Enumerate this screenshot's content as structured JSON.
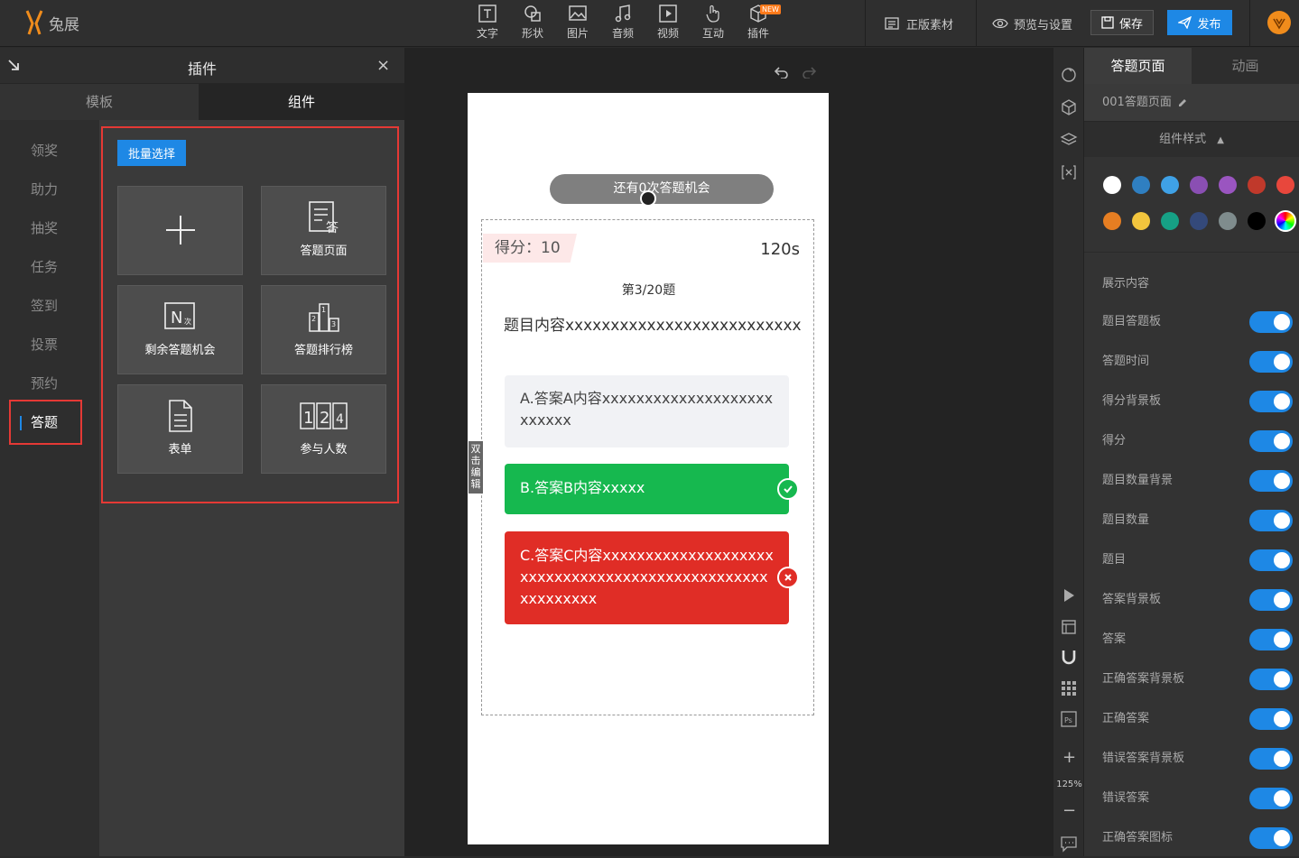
{
  "app": {
    "logo_text": "兔展"
  },
  "toolbar": {
    "tools": [
      {
        "label": "文字",
        "icon": "text-icon"
      },
      {
        "label": "形状",
        "icon": "shape-icon"
      },
      {
        "label": "图片",
        "icon": "image-icon"
      },
      {
        "label": "音频",
        "icon": "music-icon"
      },
      {
        "label": "视频",
        "icon": "video-icon"
      },
      {
        "label": "互动",
        "icon": "hand-icon"
      },
      {
        "label": "插件",
        "icon": "cube-icon",
        "badge": "NEW"
      }
    ],
    "licensed_material": "正版素材",
    "preview_settings": "预览与设置",
    "save": "保存",
    "publish": "发布"
  },
  "plugin_panel": {
    "title": "插件",
    "tabs": [
      "模板",
      "组件"
    ],
    "categories": [
      "领奖",
      "助力",
      "抽奖",
      "任务",
      "签到",
      "投票",
      "预约",
      "答题"
    ],
    "active_category": "答题",
    "batch_select": "批量选择",
    "components": [
      "",
      "答题页面",
      "剩余答题机会",
      "答题排行榜",
      "表单",
      "参与人数"
    ]
  },
  "canvas": {
    "chance_text": "还有0次答题机会",
    "score_label": "得分：10",
    "timer": "120s",
    "progress": "第3/20题",
    "question": "题目内容xxxxxxxxxxxxxxxxxxxxxxxxxx",
    "answer_a": "A.答案A内容xxxxxxxxxxxxxxxxxxxxxxxxxx",
    "answer_b": "B.答案B内容xxxxx",
    "answer_c": "C.答案C内容xxxxxxxxxxxxxxxxxxxxxxxxxxxxxxxxxxxxxxxxxxxxxxxxxxxxxxxxxx",
    "edit_tab": "双击编辑"
  },
  "tool_column": {
    "zoom": "125%"
  },
  "prop_panel": {
    "tabs": [
      "答题页面",
      "动画"
    ],
    "page_name": "001答题页面",
    "style_header": "组件样式",
    "colors": [
      "#ffffff",
      "#2f7fc1",
      "#3fa1e6",
      "#8a4fb3",
      "#9a55c0",
      "#c0392b",
      "#e8473c",
      "#e67e22",
      "#f2c53d",
      "#16a085",
      "#34497a",
      "#7f8c8d",
      "#000000"
    ],
    "section_label": "展示内容",
    "toggles": [
      "题目答题板",
      "答题时间",
      "得分背景板",
      "得分",
      "题目数量背景",
      "题目数量",
      "题目",
      "答案背景板",
      "答案",
      "正确答案背景板",
      "正确答案",
      "错误答案背景板",
      "错误答案",
      "正确答案图标"
    ]
  }
}
